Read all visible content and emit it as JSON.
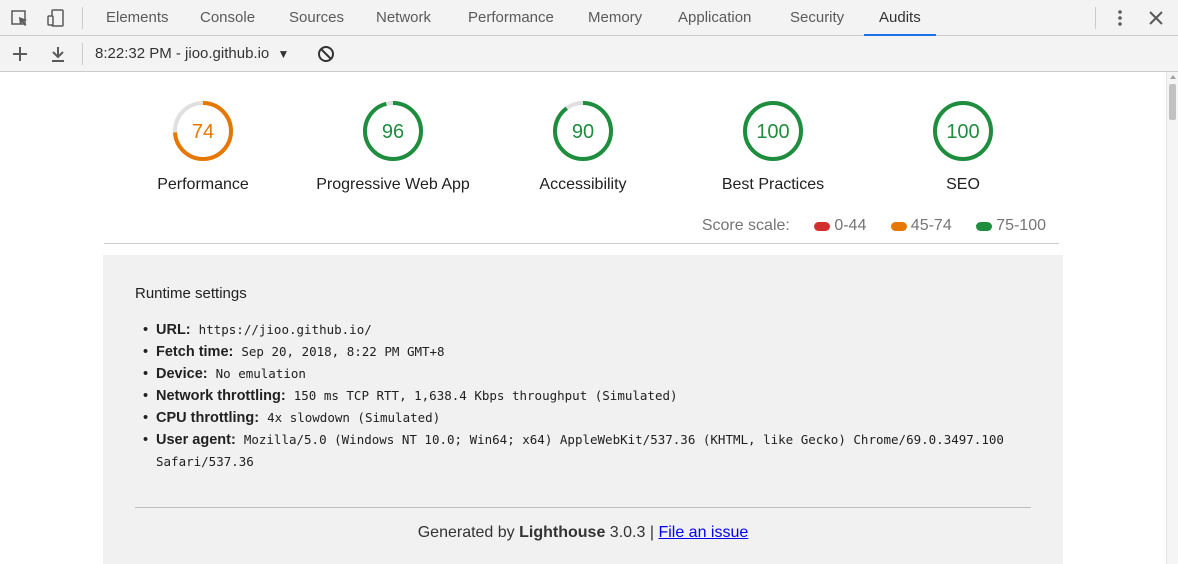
{
  "devtools": {
    "tabs": [
      "Elements",
      "Console",
      "Sources",
      "Network",
      "Performance",
      "Memory",
      "Application",
      "Security",
      "Audits"
    ],
    "active_tab": "Audits",
    "report_selector": "8:22:32 PM - jioo.github.io"
  },
  "scores": [
    {
      "label": "Performance",
      "value": "74",
      "score": 74,
      "color": "#e67700"
    },
    {
      "label": "Progressive Web App",
      "value": "96",
      "score": 96,
      "color": "#1e8e3e"
    },
    {
      "label": "Accessibility",
      "value": "90",
      "score": 90,
      "color": "#1e8e3e"
    },
    {
      "label": "Best Practices",
      "value": "100",
      "score": 100,
      "color": "#1e8e3e"
    },
    {
      "label": "SEO",
      "value": "100",
      "score": 100,
      "color": "#1e8e3e"
    }
  ],
  "score_scale": {
    "label": "Score scale:",
    "ranges": [
      {
        "text": "0-44",
        "color": "#d32f2f"
      },
      {
        "text": "45-74",
        "color": "#e67700"
      },
      {
        "text": "75-100",
        "color": "#1e8e3e"
      }
    ]
  },
  "runtime": {
    "title": "Runtime settings",
    "items": [
      {
        "key": "URL:",
        "value": "https://jioo.github.io/"
      },
      {
        "key": "Fetch time:",
        "value": "Sep 20, 2018, 8:22 PM GMT+8"
      },
      {
        "key": "Device:",
        "value": "No emulation"
      },
      {
        "key": "Network throttling:",
        "value": "150 ms TCP RTT, 1,638.4 Kbps throughput (Simulated)"
      },
      {
        "key": "CPU throttling:",
        "value": "4x slowdown (Simulated)"
      },
      {
        "key": "User agent:",
        "value": "Mozilla/5.0 (Windows NT 10.0; Win64; x64) AppleWebKit/537.36 (KHTML, like Gecko) Chrome/69.0.3497.100 Safari/537.36"
      }
    ]
  },
  "footer": {
    "prefix": "Generated by",
    "product": "Lighthouse",
    "version": "3.0.3 |",
    "link": "File an issue"
  }
}
